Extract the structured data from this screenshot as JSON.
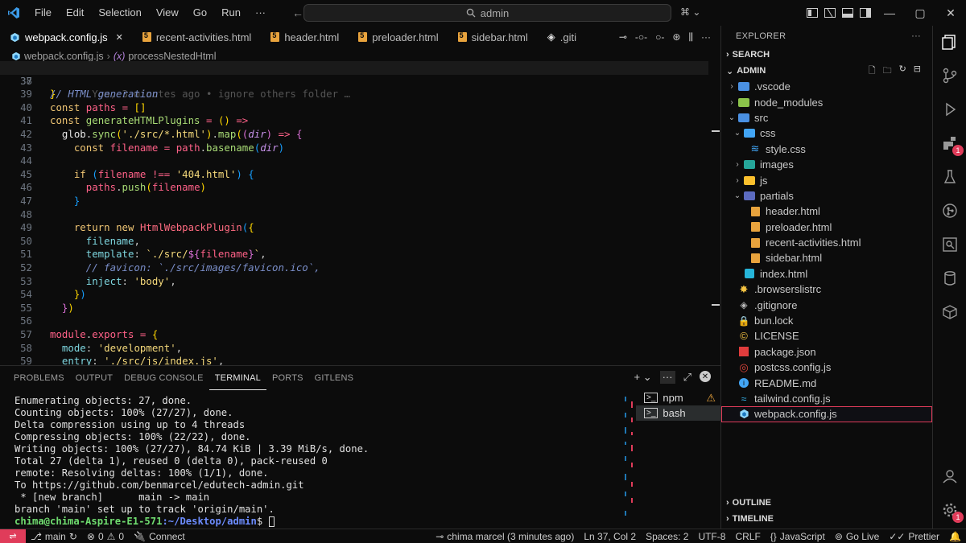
{
  "menu": [
    "File",
    "Edit",
    "Selection",
    "View",
    "Go",
    "Run",
    "···"
  ],
  "search": {
    "placeholder": "admin"
  },
  "tabs": [
    {
      "label": "webpack.config.js",
      "icon": "webpack-icon",
      "active": true
    },
    {
      "label": "recent-activities.html",
      "icon": "html5-icon"
    },
    {
      "label": "header.html",
      "icon": "html5-icon"
    },
    {
      "label": "preloader.html",
      "icon": "html5-icon"
    },
    {
      "label": "sidebar.html",
      "icon": "html5-icon"
    },
    {
      "label": ".giti",
      "icon": "git-icon"
    }
  ],
  "breadcrumb": {
    "file": "webpack.config.js",
    "symbol": "processNestedHtml",
    "symbol_prefix": "(x)"
  },
  "editor": {
    "lines": [
      {
        "n": "37",
        "text": "}",
        "blame": "You, 3 minutes ago • ignore others folder …"
      },
      {
        "n": "38",
        "text": ""
      },
      {
        "n": "39",
        "text": "// HTML generation"
      },
      {
        "n": "40",
        "text": "const paths = []"
      },
      {
        "n": "41",
        "text": "const generateHTMLPlugins = () =>"
      },
      {
        "n": "42",
        "text": "  glob.sync('./src/*.html').map((dir) => {"
      },
      {
        "n": "43",
        "text": "    const filename = path.basename(dir)"
      },
      {
        "n": "44",
        "text": ""
      },
      {
        "n": "45",
        "text": "    if (filename !== '404.html') {"
      },
      {
        "n": "46",
        "text": "      paths.push(filename)"
      },
      {
        "n": "47",
        "text": "    }"
      },
      {
        "n": "48",
        "text": ""
      },
      {
        "n": "49",
        "text": "    return new HtmlWebpackPlugin({"
      },
      {
        "n": "50",
        "text": "      filename,"
      },
      {
        "n": "51",
        "text": "      template: `./src/${filename}`,"
      },
      {
        "n": "52",
        "text": "      // favicon: `./src/images/favicon.ico`,"
      },
      {
        "n": "53",
        "text": "      inject: 'body',"
      },
      {
        "n": "54",
        "text": "    })"
      },
      {
        "n": "55",
        "text": "  })"
      },
      {
        "n": "56",
        "text": ""
      },
      {
        "n": "57",
        "text": "module.exports = {"
      },
      {
        "n": "58",
        "text": "  mode: 'development',"
      },
      {
        "n": "59",
        "text": "  entry: './src/js/index.js',"
      }
    ]
  },
  "panel": {
    "tabs": [
      "PROBLEMS",
      "OUTPUT",
      "DEBUG CONSOLE",
      "TERMINAL",
      "PORTS",
      "GITLENS"
    ],
    "active_tab": "TERMINAL",
    "terminal_lines": [
      "Enumerating objects: 27, done.",
      "Counting objects: 100% (27/27), done.",
      "Delta compression using up to 4 threads",
      "Compressing objects: 100% (22/22), done.",
      "Writing objects: 100% (27/27), 84.74 KiB | 3.39 MiB/s, done.",
      "Total 27 (delta 1), reused 0 (delta 0), pack-reused 0",
      "remote: Resolving deltas: 100% (1/1), done.",
      "To https://github.com/benmarcel/edutech-admin.git",
      " * [new branch]      main -> main",
      "branch 'main' set up to track 'origin/main'."
    ],
    "prompt_user": "chima@chima-Aspire-E1-571",
    "prompt_path": ":~/Desktop/admin",
    "prompt_symbol": "$",
    "terminals": [
      {
        "label": "npm",
        "warning": true
      },
      {
        "label": "bash",
        "selected": true
      }
    ]
  },
  "explorer": {
    "title": "EXPLORER",
    "search_section": "SEARCH",
    "root": "ADMIN",
    "items": [
      {
        "label": ".vscode",
        "depth": 1,
        "type": "folder",
        "color": "#4a90e2",
        "chev": "›"
      },
      {
        "label": "node_modules",
        "depth": 1,
        "type": "folder",
        "color": "#8bc34a",
        "chev": "›"
      },
      {
        "label": "src",
        "depth": 1,
        "type": "folder-open",
        "color": "#4a90e2",
        "chev": "⌄"
      },
      {
        "label": "css",
        "depth": 2,
        "type": "folder-open",
        "color": "#42a5f5",
        "chev": "⌄"
      },
      {
        "label": "style.css",
        "depth": 3,
        "type": "css"
      },
      {
        "label": "images",
        "depth": 2,
        "type": "folder",
        "color": "#26a69a",
        "chev": "›"
      },
      {
        "label": "js",
        "depth": 2,
        "type": "folder",
        "color": "#fbc02d",
        "chev": "›"
      },
      {
        "label": "partials",
        "depth": 2,
        "type": "folder-open",
        "color": "#5c6bc0",
        "chev": "⌄"
      },
      {
        "label": "header.html",
        "depth": 3,
        "type": "html"
      },
      {
        "label": "preloader.html",
        "depth": 3,
        "type": "html"
      },
      {
        "label": "recent-activities.html",
        "depth": 3,
        "type": "html"
      },
      {
        "label": "sidebar.html",
        "depth": 3,
        "type": "html"
      },
      {
        "label": "index.html",
        "depth": 2,
        "type": "html-blue"
      },
      {
        "label": ".browserslistrc",
        "depth": 1,
        "type": "browserslist"
      },
      {
        "label": ".gitignore",
        "depth": 1,
        "type": "git"
      },
      {
        "label": "bun.lock",
        "depth": 1,
        "type": "lock"
      },
      {
        "label": "LICENSE",
        "depth": 1,
        "type": "license"
      },
      {
        "label": "package.json",
        "depth": 1,
        "type": "npm"
      },
      {
        "label": "postcss.config.js",
        "depth": 1,
        "type": "postcss"
      },
      {
        "label": "README.md",
        "depth": 1,
        "type": "readme"
      },
      {
        "label": "tailwind.config.js",
        "depth": 1,
        "type": "tailwind"
      },
      {
        "label": "webpack.config.js",
        "depth": 1,
        "type": "webpack",
        "selected": true
      }
    ],
    "outline": "OUTLINE",
    "timeline": "TIMELINE"
  },
  "activity_badges": {
    "extensions": "1",
    "accounts": "1"
  },
  "statusbar": {
    "branch": "main",
    "errors": "0",
    "warnings": "0",
    "connect": "Connect",
    "blame": "chima marcel (3 minutes ago)",
    "position": "Ln 37, Col 2",
    "spaces": "Spaces: 2",
    "encoding": "UTF-8",
    "eol": "CRLF",
    "language": "JavaScript",
    "golive": "Go Live",
    "prettier": "Prettier"
  },
  "colors": {
    "accent": "#e03c5a",
    "background": "#0c0c0c"
  }
}
